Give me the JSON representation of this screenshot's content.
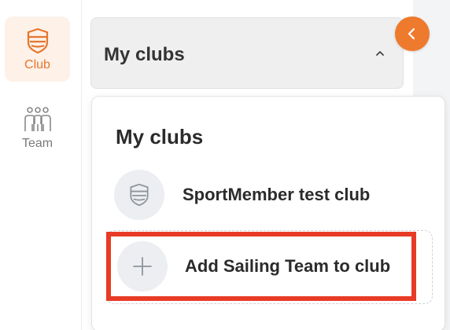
{
  "rail": {
    "items": [
      {
        "label": "Club",
        "icon": "shield-icon",
        "active": true
      },
      {
        "label": "Team",
        "icon": "team-icon",
        "active": false
      }
    ]
  },
  "selector": {
    "label": "My clubs",
    "icon": "chevron-up-icon"
  },
  "collapse_button": {
    "icon": "chevron-left-icon"
  },
  "dropdown": {
    "title": "My clubs",
    "clubs": [
      {
        "name": "SportMember test club",
        "icon": "shield-icon"
      }
    ],
    "add_action": {
      "label": "Add Sailing Team to club",
      "icon": "plus-icon"
    }
  },
  "colors": {
    "accent": "#ee7a2e",
    "highlight_border": "#e83b25",
    "active_bg": "#fdf1e8"
  }
}
